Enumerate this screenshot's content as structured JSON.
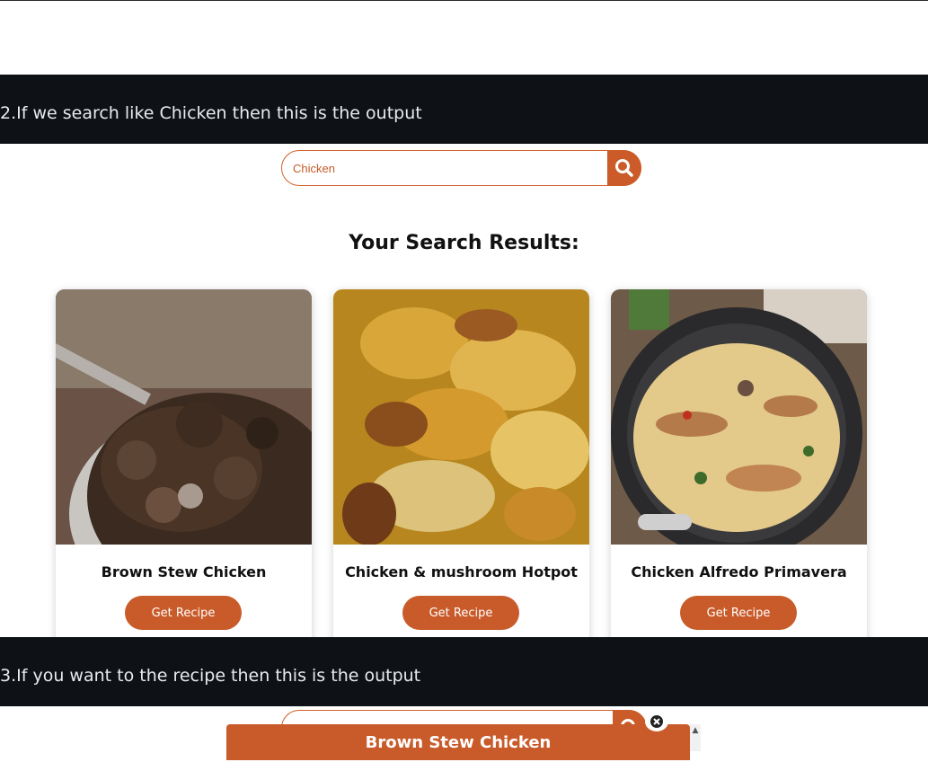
{
  "section2": {
    "caption": "2.If we search like Chicken then this is the output"
  },
  "search": {
    "value": "Chicken",
    "icon": "search-icon"
  },
  "results": {
    "heading": "Your Search Results:",
    "cards": [
      {
        "title": "Brown Stew Chicken",
        "button": "Get Recipe"
      },
      {
        "title": "Chicken & mushroom Hotpot",
        "button": "Get Recipe"
      },
      {
        "title": "Chicken Alfredo Primavera",
        "button": "Get Recipe"
      }
    ]
  },
  "section3": {
    "caption": "3.If you want to the recipe then this is the output"
  },
  "modal": {
    "title": "Brown Stew Chicken"
  },
  "colors": {
    "accent": "#c95b2a",
    "banner": "#0e1217",
    "text": "#111111"
  }
}
